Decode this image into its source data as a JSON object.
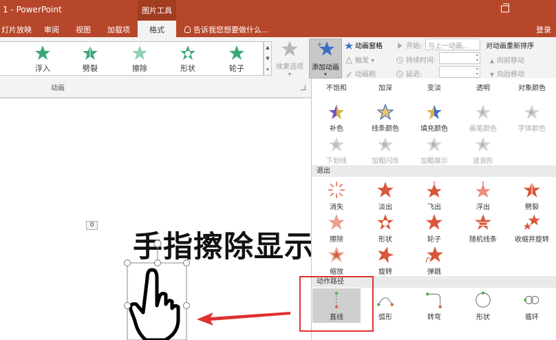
{
  "titlebar": {
    "doc_title": "1 - PowerPoint",
    "context_tab_group": "图片工具"
  },
  "menu": {
    "tabs": [
      "灯片放映",
      "审阅",
      "视图",
      "加载项"
    ],
    "active_tab": "格式",
    "tell_me": "告诉我您想要做什么...",
    "login": "登录"
  },
  "ribbon": {
    "gallery_items": [
      "浮入",
      "劈裂",
      "擦除",
      "形状",
      "轮子"
    ],
    "effect_options": "效果选项",
    "group_label": "动画",
    "add_animation": "添加动画",
    "animation_pane": "动画窗格",
    "trigger": "触发",
    "animation_painter": "动画刷",
    "start_label": "开始:",
    "start_value": "与上一动画...",
    "duration_label": "持续时间:",
    "delay_label": "延迟:",
    "reorder_title": "对动画重新排序",
    "move_earlier": "向前移动",
    "move_later": "向后移动"
  },
  "slide": {
    "animation_counter": "0",
    "title_text": "手指擦除显示"
  },
  "panel": {
    "emphasis_row1": [
      "不饱和",
      "加深",
      "变淡",
      "透明",
      "对象颜色"
    ],
    "emphasis_row2": [
      "补色",
      "线条颜色",
      "填充颜色",
      "画笔颜色",
      "字体颜色"
    ],
    "emphasis_row3": [
      "下划线",
      "加粗闪烁",
      "加粗展示",
      "波浪形"
    ],
    "exit_header": "退出",
    "exit_row1": [
      "消失",
      "淡出",
      "飞出",
      "浮出",
      "劈裂"
    ],
    "exit_row2": [
      "擦除",
      "形状",
      "轮子",
      "随机线条",
      "收缩并旋转"
    ],
    "exit_row3": [
      "缩放",
      "旋转",
      "弹跳"
    ],
    "path_header": "动作路径",
    "path_row1": [
      "直线",
      "弧形",
      "转弯",
      "形状",
      "循环"
    ]
  },
  "colors": {
    "title_bar": "#b7472a",
    "exit_star": "#d9573a",
    "entrance_star": "#2c9b6a",
    "annotation_red": "#e03030"
  }
}
